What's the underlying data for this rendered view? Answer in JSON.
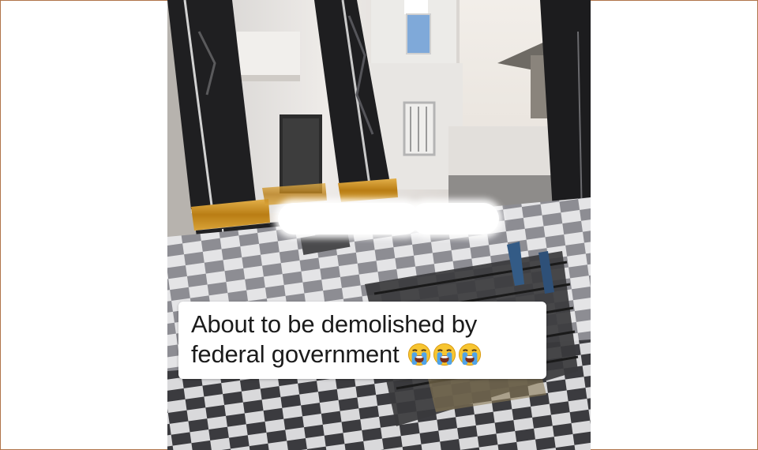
{
  "caption": {
    "line1": "About to be demolished by",
    "line2": "federal government",
    "emoji_count": 3,
    "emoji_icon": "loudly-crying-face-icon"
  },
  "scene": {
    "description_icon": "house-demolition-photo",
    "colors": {
      "frame_border": "#b0744a",
      "wall": "#e6e3e0",
      "pillar_marble": "#202020",
      "gold_band": "#c8901c",
      "sky": "#e8e3dc"
    }
  }
}
